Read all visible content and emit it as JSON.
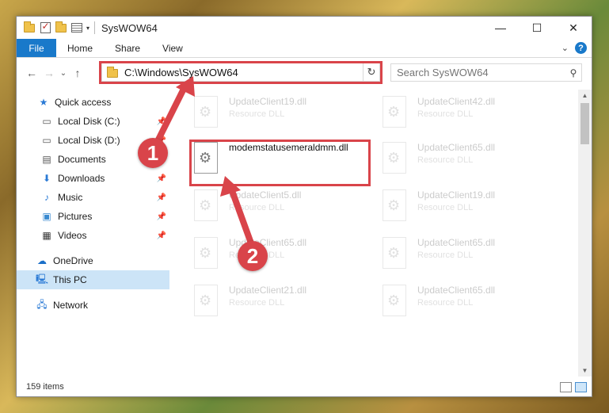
{
  "window": {
    "title": "SysWOW64",
    "controls": {
      "minimize": "—",
      "maximize": "☐",
      "close": "✕"
    }
  },
  "ribbon": {
    "file_tab": "File",
    "tabs": [
      "Home",
      "Share",
      "View"
    ],
    "expand_icon": "chevron-down-icon",
    "help_icon": "?"
  },
  "navigation": {
    "back": "←",
    "forward": "→",
    "recent": "⌄",
    "up": "↑",
    "address_path": "C:\\Windows\\SysWOW64",
    "search_placeholder": "Search SysWOW64"
  },
  "sidebar": {
    "items": [
      {
        "label": "Quick access",
        "icon": "star-icon",
        "pinned": false
      },
      {
        "label": "Local Disk (C:)",
        "icon": "drive-icon",
        "pinned": true
      },
      {
        "label": "Local Disk (D:)",
        "icon": "drive-icon",
        "pinned": true
      },
      {
        "label": "Documents",
        "icon": "documents-icon",
        "pinned": true
      },
      {
        "label": "Downloads",
        "icon": "download-icon",
        "pinned": true
      },
      {
        "label": "Music",
        "icon": "music-icon",
        "pinned": true
      },
      {
        "label": "Pictures",
        "icon": "pictures-icon",
        "pinned": true
      },
      {
        "label": "Videos",
        "icon": "videos-icon",
        "pinned": true
      },
      {
        "label": "OneDrive",
        "icon": "cloud-icon",
        "pinned": false
      },
      {
        "label": "This PC",
        "icon": "computer-icon",
        "pinned": false,
        "selected": true
      },
      {
        "label": "Network",
        "icon": "network-icon",
        "pinned": false
      }
    ]
  },
  "files": [
    {
      "name": "UpdateClient19.dll",
      "desc": "Resource DLL"
    },
    {
      "name": "UpdateClient42.dll",
      "desc": "Resource DLL"
    },
    {
      "name": "modemstatusemeraldmm.dll",
      "desc": ""
    },
    {
      "name": "UpdateClient65.dll",
      "desc": "Resource DLL"
    },
    {
      "name": "UpdateClient5.dll",
      "desc": "Resource DLL"
    },
    {
      "name": "UpdateClient19.dll",
      "desc": "Resource DLL"
    },
    {
      "name": "UpdateClient65.dll",
      "desc": "Resource DLL"
    },
    {
      "name": "UpdateClient65.dll",
      "desc": "Resource DLL"
    },
    {
      "name": "UpdateClient21.dll",
      "desc": "Resource DLL"
    },
    {
      "name": "UpdateClient65.dll",
      "desc": "Resource DLL"
    }
  ],
  "status": {
    "item_count": "159 items"
  },
  "annotations": {
    "step1": "1",
    "step2": "2",
    "color": "#d9444a"
  }
}
